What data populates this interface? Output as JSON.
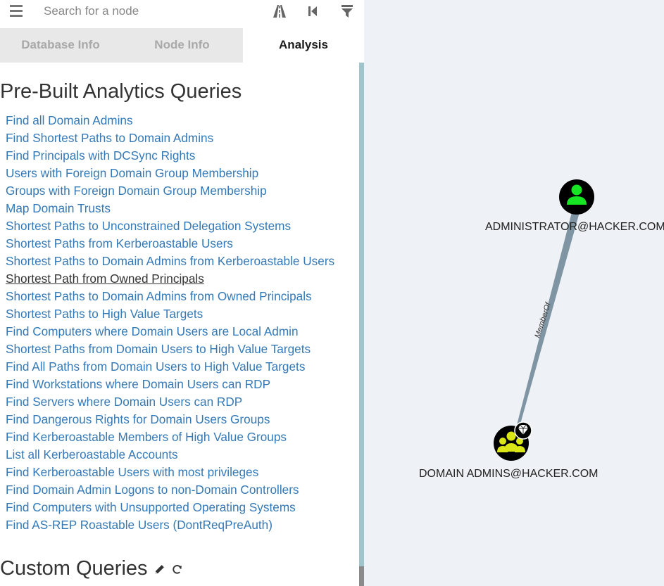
{
  "search": {
    "placeholder": "Search for a node"
  },
  "tabs": [
    {
      "label": "Database Info"
    },
    {
      "label": "Node Info"
    },
    {
      "label": "Analysis"
    }
  ],
  "analysis": {
    "prebuilt_title": "Pre-Built Analytics Queries",
    "queries": [
      "Find all Domain Admins",
      "Find Shortest Paths to Domain Admins",
      "Find Principals with DCSync Rights",
      "Users with Foreign Domain Group Membership",
      "Groups with Foreign Domain Group Membership",
      "Map Domain Trusts",
      "Shortest Paths to Unconstrained Delegation Systems",
      "Shortest Paths from Kerberoastable Users",
      "Shortest Paths to Domain Admins from Kerberoastable Users",
      "Shortest Path from Owned Principals",
      "Shortest Paths to Domain Admins from Owned Principals",
      "Shortest Paths to High Value Targets",
      "Find Computers where Domain Users are Local Admin",
      "Shortest Paths from Domain Users to High Value Targets",
      "Find All Paths from Domain Users to High Value Targets",
      "Find Workstations where Domain Users can RDP",
      "Find Servers where Domain Users can RDP",
      "Find Dangerous Rights for Domain Users Groups",
      "Find Kerberoastable Members of High Value Groups",
      "List all Kerberoastable Accounts",
      "Find Kerberoastable Users with most privileges",
      "Find Domain Admin Logons to non-Domain Controllers",
      "Find Computers with Unsupported Operating Systems",
      "Find AS-REP Roastable Users (DontReqPreAuth)"
    ],
    "hovered_query": "Shortest Path from Owned Principals",
    "custom_title": "Custom Queries"
  },
  "graph": {
    "nodes": [
      {
        "id": "user",
        "label": "ADMINISTRATOR@HACKER.COM",
        "kind": "user",
        "color": "#17e625"
      },
      {
        "id": "group",
        "label": "DOMAIN ADMINS@HACKER.COM",
        "kind": "group",
        "color": "#dbe617",
        "high_value": true
      }
    ],
    "edges": [
      {
        "from": "user",
        "to": "group",
        "label": "MemberOf"
      }
    ]
  },
  "icons": {
    "menu": "hamburger-menu-icon",
    "pathfinding": "road-icon",
    "back": "step-backward-icon",
    "filter": "filter-icon",
    "edit": "pencil-icon",
    "refresh": "refresh-icon",
    "high_value": "gem-icon"
  },
  "colors": {
    "link": "#3479b7",
    "user_node": "#17e625",
    "group_node": "#dbe617",
    "edge": "#7f95a3",
    "scrollbar": "#9fc4cb"
  }
}
